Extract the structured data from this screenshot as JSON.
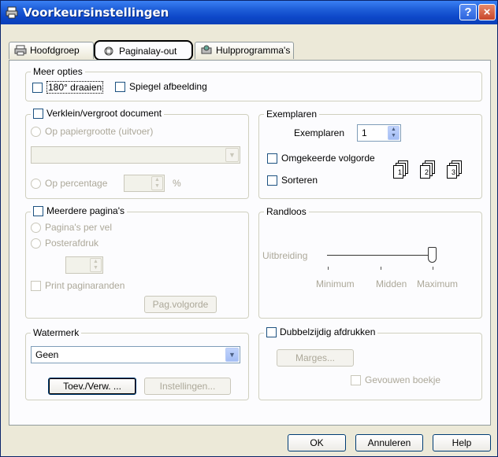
{
  "window": {
    "title": "Voorkeursinstellingen",
    "help_btn": "?",
    "close_btn": "×"
  },
  "tabs": [
    {
      "label": "Hoofdgroep",
      "icon": "printer-icon"
    },
    {
      "label": "Paginalay-out",
      "icon": "page-layout-icon",
      "active": true
    },
    {
      "label": "Hulpprogramma's",
      "icon": "utility-icon"
    }
  ],
  "meer_opties": {
    "legend": "Meer opties",
    "rotate": "180° draaien",
    "mirror": "Spiegel afbeelding"
  },
  "verklein": {
    "legend": "Verklein/vergroot document",
    "op_papiergrootte": "Op papiergrootte (uitvoer)",
    "op_percentage": "Op percentage",
    "percent_sign": "%"
  },
  "exemplaren": {
    "legend": "Exemplaren",
    "label": "Exemplaren",
    "value": "1",
    "omgekeerde": "Omgekeerde volgorde",
    "sorteren": "Sorteren",
    "collate_pages": [
      "1",
      "2",
      "3"
    ]
  },
  "meerdere": {
    "legend": "Meerdere pagina's",
    "per_vel": "Pagina's per vel",
    "poster": "Posterafdruk",
    "print_randen": "Print paginaranden",
    "volgorde_btn": "Pag.volgorde"
  },
  "randloos": {
    "legend": "Randloos",
    "uitbreiding": "Uitbreiding",
    "ticks": [
      "Minimum",
      "Midden",
      "Maximum"
    ],
    "level": "Maximum"
  },
  "watermerk": {
    "legend": "Watermerk",
    "value": "Geen",
    "toev_btn": "Toev./Verw. ...",
    "instellingen_btn": "Instellingen..."
  },
  "dubbel": {
    "legend": "Dubbelzijdig afdrukken",
    "marges_btn": "Marges...",
    "boekje": "Gevouwen boekje"
  },
  "footer": {
    "ok": "OK",
    "annuleren": "Annuleren",
    "help": "Help"
  }
}
